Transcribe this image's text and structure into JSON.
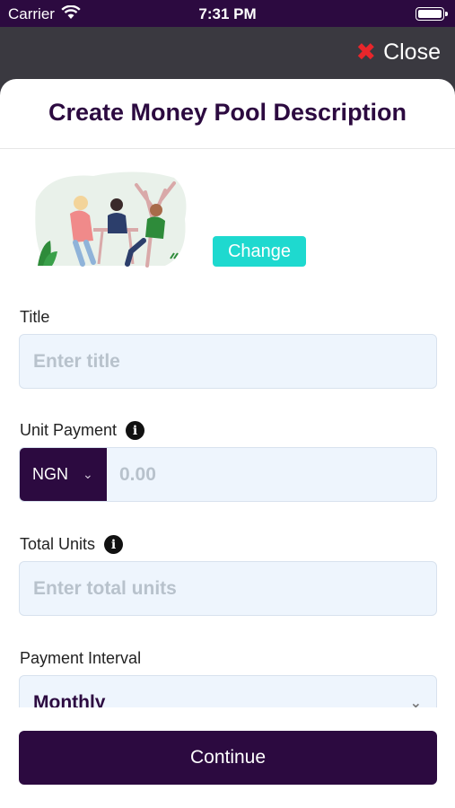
{
  "status": {
    "carrier": "Carrier",
    "time": "7:31 PM"
  },
  "topbar": {
    "close_label": "Close"
  },
  "header": {
    "title": "Create Money Pool Description"
  },
  "image": {
    "change_label": "Change"
  },
  "form": {
    "title": {
      "label": "Title",
      "placeholder": "Enter title"
    },
    "unit_payment": {
      "label": "Unit Payment",
      "currency": "NGN",
      "placeholder": "0.00"
    },
    "total_units": {
      "label": "Total Units",
      "placeholder": "Enter total units"
    },
    "payment_interval": {
      "label": "Payment Interval",
      "value": "Monthly"
    }
  },
  "footer": {
    "continue_label": "Continue"
  },
  "colors": {
    "brand": "#2c0a40",
    "accent": "#1ed9cf",
    "close": "#e8262b"
  }
}
